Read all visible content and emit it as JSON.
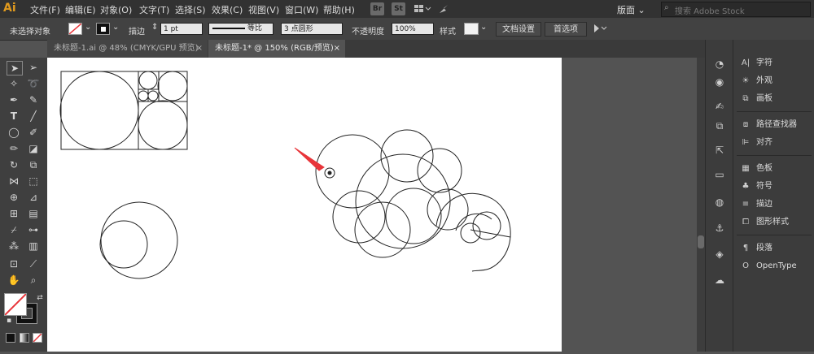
{
  "app": {
    "logo": "Ai"
  },
  "menu": [
    "文件(F)",
    "编辑(E)",
    "对象(O)",
    "文字(T)",
    "选择(S)",
    "效果(C)",
    "视图(V)",
    "窗口(W)",
    "帮助(H)"
  ],
  "app_buttons": [
    "Br",
    "St"
  ],
  "workspace": {
    "label": "版面"
  },
  "search": {
    "placeholder": "搜索 Adobe Stock"
  },
  "control_bar": {
    "selection_status": "未选择对象",
    "stroke_label": "描边",
    "stroke_weight": "1 pt",
    "profile_label": "等比",
    "brush": "3 点圆形",
    "opacity_label": "不透明度",
    "opacity_value": "100%",
    "style_label": "样式",
    "doc_setup": "文档设置",
    "preferences": "首选项"
  },
  "tabs": [
    {
      "label": "未标题-1.ai @ 48% (CMYK/GPU 预览)",
      "active": false
    },
    {
      "label": "未标题-1* @ 150% (RGB/预览)",
      "active": true
    }
  ],
  "panels": [
    {
      "icon": "character-icon",
      "label": "字符"
    },
    {
      "icon": "appearance-icon",
      "label": "外观"
    },
    {
      "icon": "artboards-icon",
      "label": "画板"
    },
    {
      "icon": "pathfinder-icon",
      "label": "路径查找器"
    },
    {
      "icon": "align-icon",
      "label": "对齐"
    },
    {
      "icon": "swatches-icon",
      "label": "色板"
    },
    {
      "icon": "symbols-icon",
      "label": "符号"
    },
    {
      "icon": "stroke-icon",
      "label": "描边"
    },
    {
      "icon": "graphic-styles-icon",
      "label": "图形样式"
    },
    {
      "icon": "paragraph-icon",
      "label": "段落"
    },
    {
      "icon": "opentype-icon",
      "label": "OpenType"
    }
  ],
  "colors": {
    "arrow": "#e8353a",
    "stroke": "#222222"
  },
  "close_glyph": "×"
}
